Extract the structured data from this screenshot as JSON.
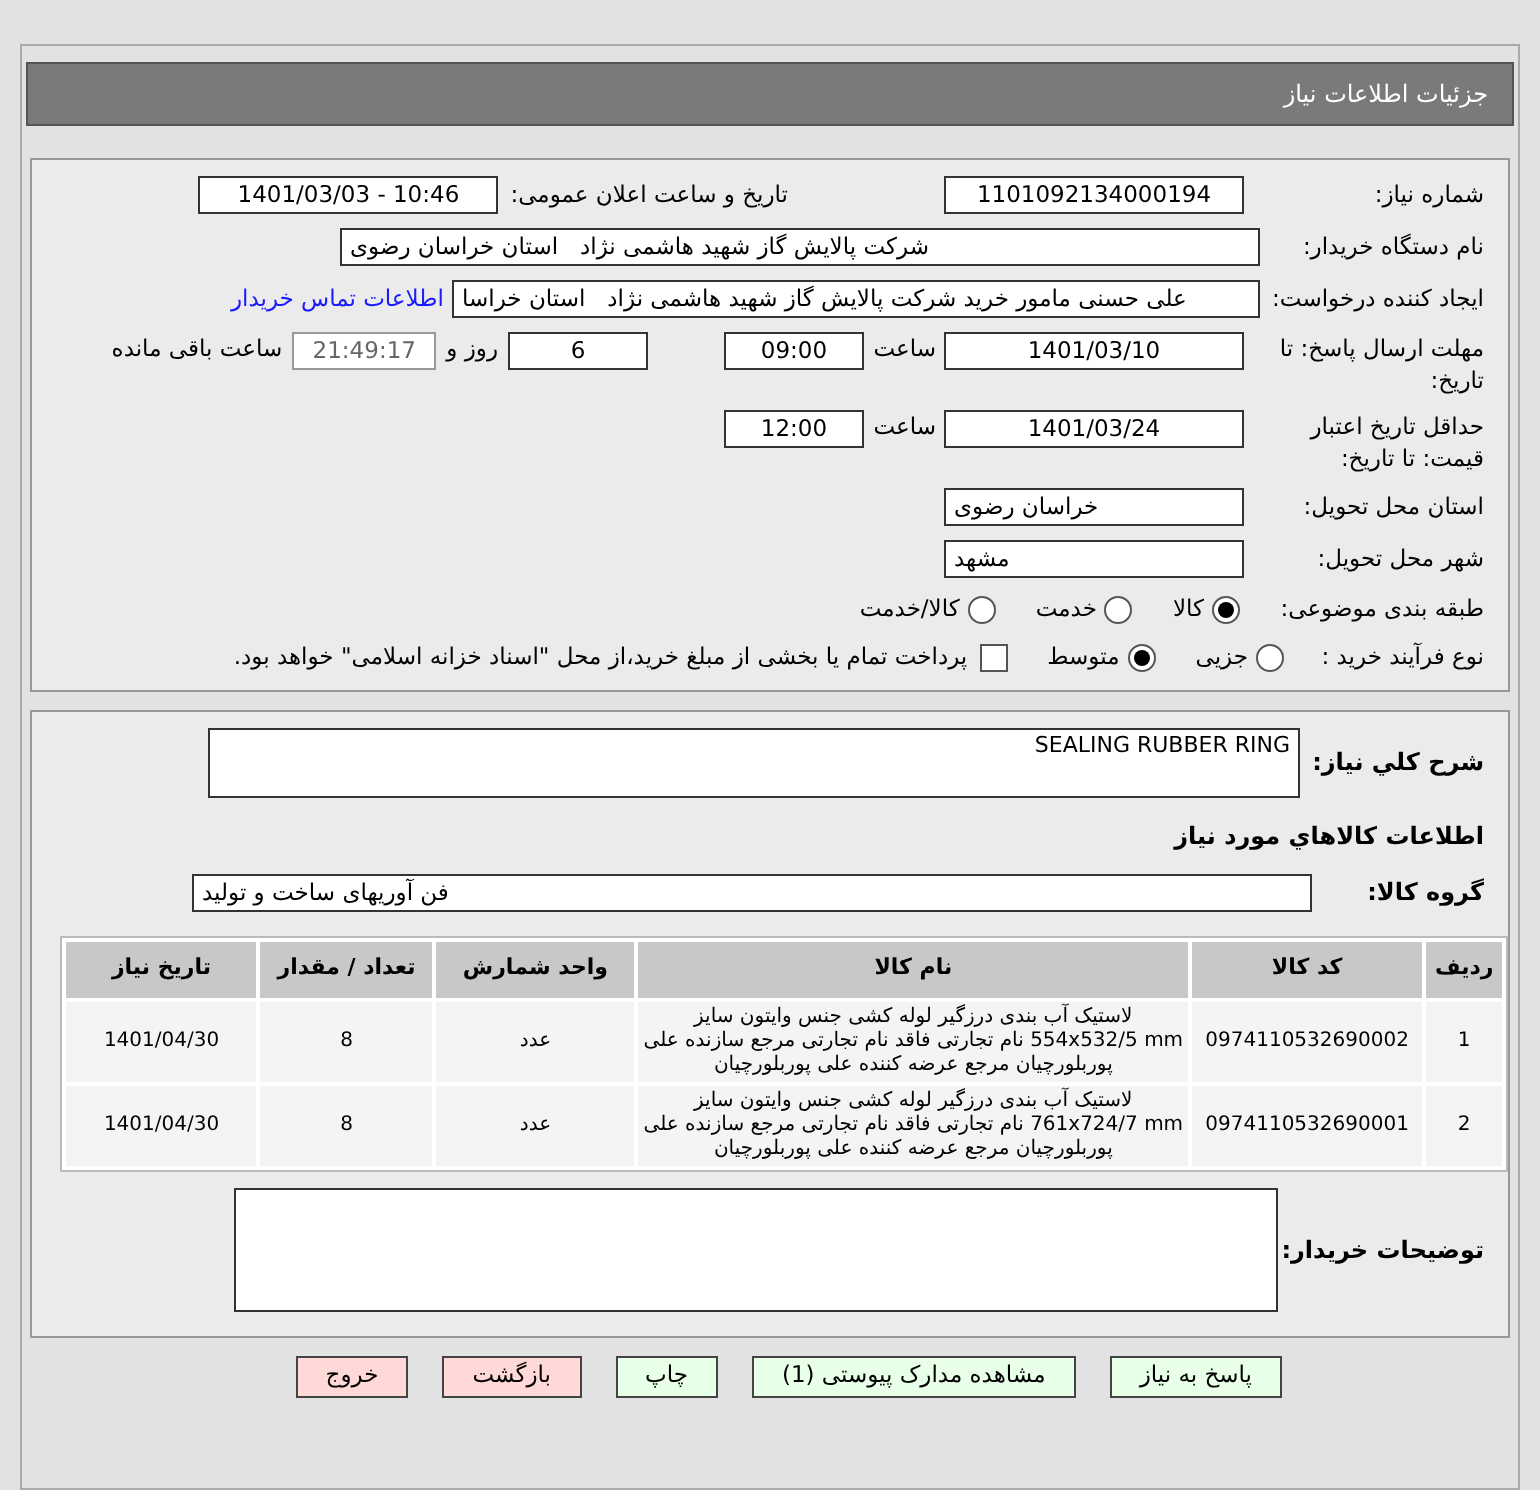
{
  "header": {
    "title": "جزئیات اطلاعات نیاز"
  },
  "need_number": {
    "label": "شماره نیاز:",
    "value": "1101092134000194"
  },
  "announce": {
    "label": "تاریخ و ساعت اعلان عمومی:",
    "value": "1401/03/03 - 10:46"
  },
  "buyer_org": {
    "label": "نام دستگاه خریدار:",
    "value": "شرکت پالایش گاز شهید هاشمی نژاد   استان خراسان رضوی"
  },
  "requester": {
    "label": "ایجاد کننده درخواست:",
    "value": "علی حسنی مامور خرید شرکت پالایش گاز شهید هاشمی نژاد   استان خراسا",
    "link": "اطلاعات تماس خریدار"
  },
  "reply_deadline": {
    "label": "مهلت ارسال پاسخ: تا تاریخ:",
    "date": "1401/03/10",
    "time_label": "ساعت",
    "time": "09:00",
    "days": "6",
    "days_label": "روز و",
    "remaining": "21:49:17",
    "remaining_label": "ساعت باقی مانده"
  },
  "price_validity": {
    "label": "حداقل تاریخ اعتبار قیمت: تا تاریخ:",
    "date": "1401/03/24",
    "time_label": "ساعت",
    "time": "12:00"
  },
  "province": {
    "label": "استان محل تحویل:",
    "value": "خراسان رضوی"
  },
  "city": {
    "label": "شهر محل تحویل:",
    "value": "مشهد"
  },
  "category": {
    "label": "طبقه بندی موضوعی:",
    "options": [
      {
        "label": "کالا",
        "selected": true
      },
      {
        "label": "خدمت",
        "selected": false
      },
      {
        "label": "کالا/خدمت",
        "selected": false
      }
    ]
  },
  "process": {
    "label": "نوع فرآیند خرید :",
    "options": [
      {
        "label": "جزیی",
        "selected": false
      },
      {
        "label": "متوسط",
        "selected": true
      }
    ],
    "payment": {
      "label": "پرداخت تمام یا بخشی از مبلغ خرید،از محل \"اسناد خزانه اسلامی\" خواهد بود.",
      "checked": false
    }
  },
  "description": {
    "label": "شرح کلي نياز:",
    "value": "SEALING RUBBER RING"
  },
  "goods_title": "اطلاعات کالاهاي مورد نياز",
  "group": {
    "label": "گروه کالا:",
    "value": "فن آوریهای ساخت و تولید"
  },
  "table": {
    "columns": [
      "ردیف",
      "کد کالا",
      "نام کالا",
      "واحد شمارش",
      "تعداد / مقدار",
      "تاریخ نیاز"
    ],
    "rows": [
      [
        "1",
        "0974110532690002",
        "لاستیک آب بندی درزگیر لوله کشی جنس وایتون سایز 554x532/5 mm نام تجارتی فاقد نام تجارتی مرجع سازنده علی پوربلورچیان مرجع عرضه کننده علی پوربلورچیان",
        "عدد",
        "8",
        "1401/04/30"
      ],
      [
        "2",
        "0974110532690001",
        "لاستیک آب بندی درزگیر لوله کشی جنس وایتون سایز 761x724/7 mm نام تجارتی فاقد نام تجارتی مرجع سازنده علی پوربلورچیان مرجع عرضه کننده علی پوربلورچیان",
        "عدد",
        "8",
        "1401/04/30"
      ]
    ]
  },
  "buyer_notes": {
    "label": "توضیحات خریدار:"
  },
  "buttons": [
    {
      "label": "پاسخ به نیاز",
      "kind": "action"
    },
    {
      "label": "مشاهده مدارک پیوستی (1)",
      "kind": "action"
    },
    {
      "label": "چاپ",
      "kind": "action"
    },
    {
      "label": "بازگشت",
      "kind": "exit"
    },
    {
      "label": "خروج",
      "kind": "exit"
    }
  ]
}
